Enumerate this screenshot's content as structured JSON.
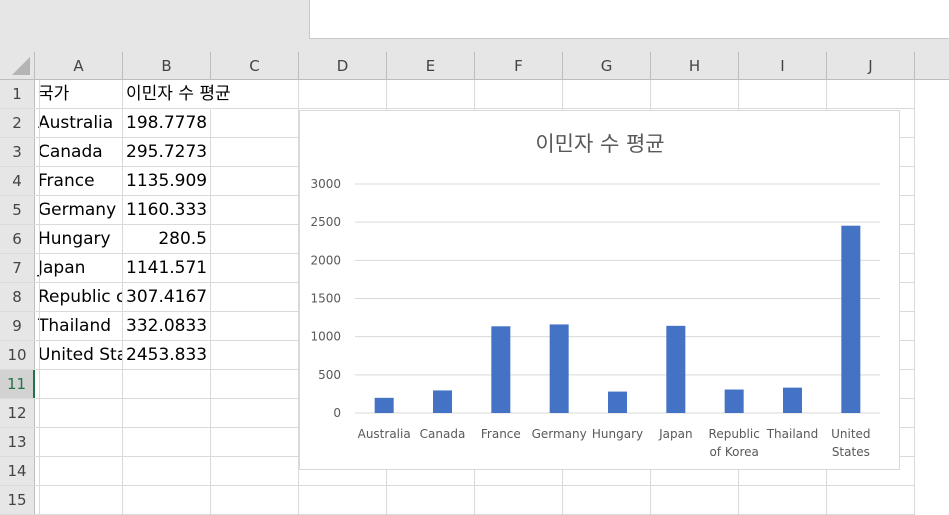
{
  "columns": [
    "A",
    "B",
    "C",
    "D",
    "E",
    "F",
    "G",
    "H",
    "I",
    "J"
  ],
  "rows": [
    "1",
    "2",
    "3",
    "4",
    "5",
    "6",
    "7",
    "8",
    "9",
    "10",
    "11",
    "12",
    "13",
    "14",
    "15"
  ],
  "active_row": "11",
  "cells": {
    "header_country": "국가",
    "header_value": "이민자 수 평균",
    "countries": [
      "Australia",
      "Canada",
      "France",
      "Germany",
      "Hungary",
      "Japan",
      "Republic c",
      "Thailand",
      "United Sta"
    ],
    "values": [
      "198.7778",
      "295.7273",
      "1135.909",
      "1160.333",
      "280.5",
      "1141.571",
      "307.4167",
      "332.0833",
      "2453.833"
    ]
  },
  "colors": {
    "bar": "#4472c4",
    "accent": "#217346"
  },
  "chart_data": {
    "type": "bar",
    "title": "이민자 수 평균",
    "categories": [
      "Australia",
      "Canada",
      "France",
      "Germany",
      "Hungary",
      "Japan",
      "Republic of Korea",
      "Thailand",
      "United States"
    ],
    "values": [
      198.7778,
      295.7273,
      1135.909,
      1160.333,
      280.5,
      1141.571,
      307.4167,
      332.0833,
      2453.833
    ],
    "ylim": [
      0,
      3000
    ],
    "yticks": [
      "0",
      "500",
      "1000",
      "1500",
      "2000",
      "2500",
      "3000"
    ],
    "grid": true,
    "legend": "none"
  }
}
